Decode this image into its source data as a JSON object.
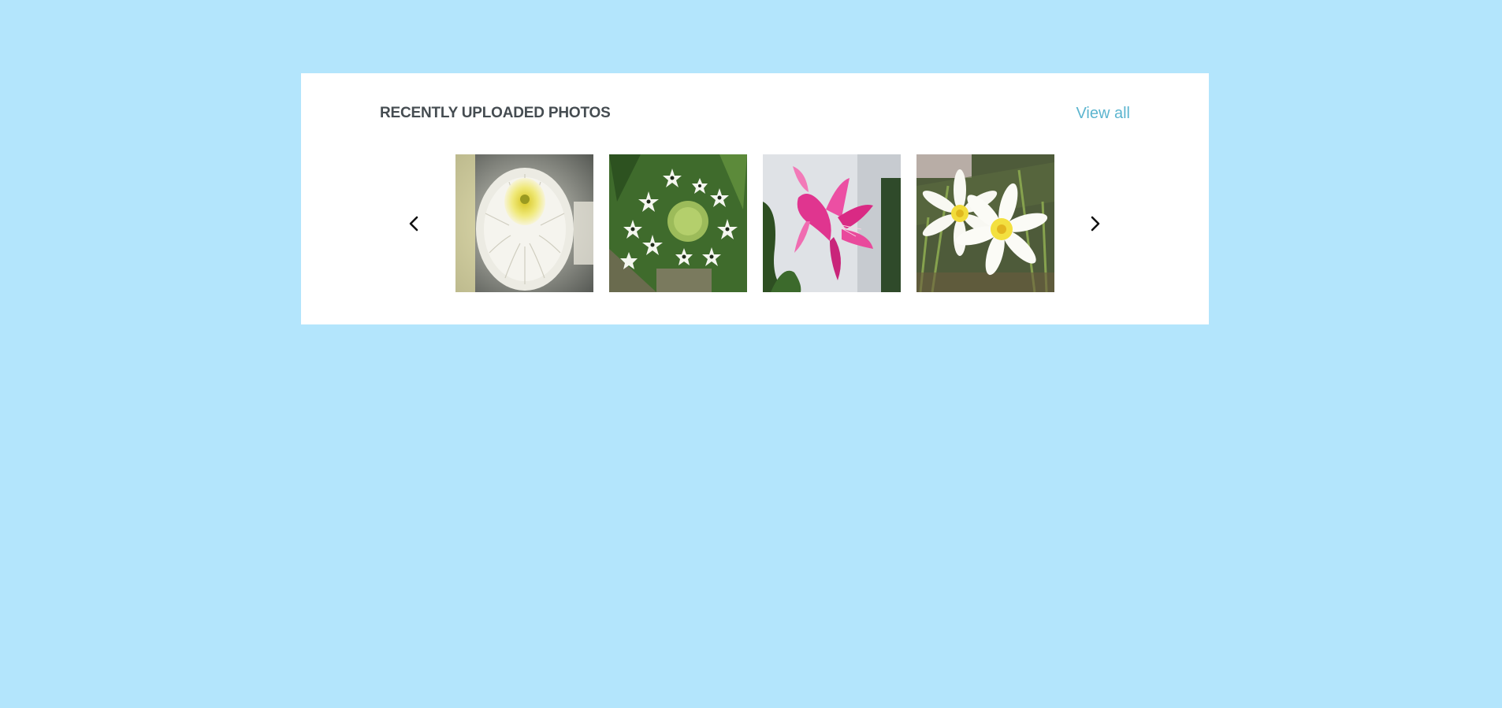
{
  "section": {
    "title": "RECENTLY UPLOADED PHOTOS",
    "view_all_label": "View all"
  },
  "carousel": {
    "prev_icon": "chevron-left-icon",
    "next_icon": "chevron-right-icon",
    "photos": [
      {
        "subject": "white-chrysanthemum"
      },
      {
        "subject": "white-star-flower-cluster"
      },
      {
        "subject": "pink-christmas-cactus"
      },
      {
        "subject": "white-yellow-zephyr-lily"
      }
    ]
  },
  "colors": {
    "page_background": "#b3e5fc",
    "card_background": "#ffffff",
    "title_text": "#454c51",
    "link_text": "#5cb5cf"
  }
}
